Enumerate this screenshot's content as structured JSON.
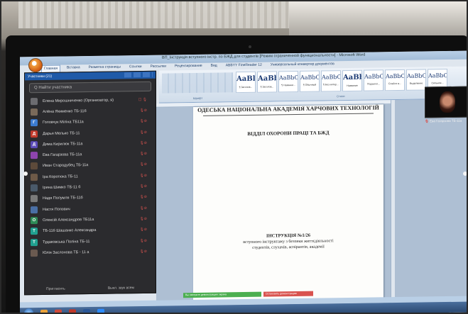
{
  "window": {
    "title": "ВП_Інструкція вступного інстр. по БЖД для студентів [Режим ограниченной функциональности] - Microsoft Word"
  },
  "ribbon": {
    "tabs": [
      "Главная",
      "Вставка",
      "Разметка страницы",
      "Ссылки",
      "Рассылки",
      "Рецензирование",
      "Вид",
      "ABBYY FineReader 12",
      "Универсальный конвертер документов"
    ],
    "styles": [
      {
        "sample": "AaBl",
        "name": "¶ Заголов..."
      },
      {
        "sample": "AaBb",
        "name": "¶ Заголов..."
      },
      {
        "sample": "AaBbCcI",
        "name": "¶ Названи..."
      },
      {
        "sample": "AaBbCcl",
        "name": "¶ Обычный"
      },
      {
        "sample": "AaBbCcDc",
        "name": "¶ Без интер..."
      },
      {
        "sample": "AaBbC",
        "name": "Название"
      },
      {
        "sample": "AaBbCcI",
        "name": "Подзагол..."
      },
      {
        "sample": "AaBbCcI",
        "name": "Слабое в..."
      },
      {
        "sample": "AaBbCcI",
        "name": "Выделение"
      },
      {
        "sample": "AaBbCc",
        "name": "Сильное..."
      }
    ],
    "groups": {
      "font": "Шрифт",
      "styles": "Стили"
    }
  },
  "participants": {
    "header": "Участники (21)",
    "search_placeholder": "Q Найти участника",
    "list": [
      {
        "name": "Елена Мирошниченко (Организатор, я)",
        "color": "#6c6c70",
        "initial": "",
        "mic": "☐ 🎙"
      },
      {
        "name": "Алёна Якименко ТБ-11б",
        "color": "#7a6a5a",
        "initial": "",
        "mic": "🎙⊘"
      },
      {
        "name": "Головчук Мiлiна ТБ11а",
        "color": "#3b7bd0",
        "initial": "Г",
        "mic": "🎙⊘"
      },
      {
        "name": "Дарья Мелько ТБ-11",
        "color": "#c0392b",
        "initial": "Д",
        "mic": "🎙⊘"
      },
      {
        "name": "Дима Кирилюк ТБ-11а",
        "color": "#5b4bb7",
        "initial": "Д",
        "mic": "🎙⊘"
      },
      {
        "name": "Ева Гагарзова ТБ-11а",
        "color": "#8e44ad",
        "initial": "",
        "mic": "🎙⊘"
      },
      {
        "name": "Иван Стародубец ТБ-11а",
        "color": "#5d4a3a",
        "initial": "",
        "mic": "🎙⊘"
      },
      {
        "name": "Іра Коротюка ТБ-11",
        "color": "#6e5a48",
        "initial": "",
        "mic": "🎙⊘"
      },
      {
        "name": "Ірина Шимко ТБ-11 б",
        "color": "#4a5a6a",
        "initial": "",
        "mic": "🎙⊘"
      },
      {
        "name": "Надя Полумля ТБ-11б",
        "color": "#7a7a7a",
        "initial": "",
        "mic": "🎙⊘"
      },
      {
        "name": "Настя Попович",
        "color": "#4a6fa5",
        "initial": "",
        "mic": "🎙⊘"
      },
      {
        "name": "Олексій Александров ТБ11а",
        "color": "#2e8b57",
        "initial": "О",
        "mic": "🎙⊘"
      },
      {
        "name": "ТБ-11б Шашанко Александра",
        "color": "#20a090",
        "initial": "Т",
        "mic": "🎙⊘"
      },
      {
        "name": "Тудаковська Поліна ТБ-11",
        "color": "#20a090",
        "initial": "Т",
        "mic": "🎙⊘"
      },
      {
        "name": "Юлія Заслонова ТБ - 11 а",
        "color": "#6a5a50",
        "initial": "",
        "mic": "🎙⊘"
      }
    ],
    "footer_invite": "Пригласить",
    "footer_mute": "Выкл. звук всем"
  },
  "document": {
    "header_line": "ОДЕСЬКА НАЦІОНАЛЬНА АКАДЕМІЯ ХАРЧОВИХ ТЕХНОЛОГІЙ",
    "department": "ВІДДІЛ ОХОРОНИ ПРАЦІ ТА БЖД",
    "instruction_title": "ІНСТРУКЦІЯ №1/26",
    "instruction_line1": "вступного інструктажу з безпеки життєдіяльності",
    "instruction_line2": "студентів, слухачів, аспірантів, академії"
  },
  "video": {
    "label_prefix": "🎙",
    "label_name": "Ева Гагарзова ТБ-11а"
  },
  "sharebar": {
    "status": "Вы смотрите демонстрацию экрана",
    "stop": "Остановить демонстрацию"
  }
}
